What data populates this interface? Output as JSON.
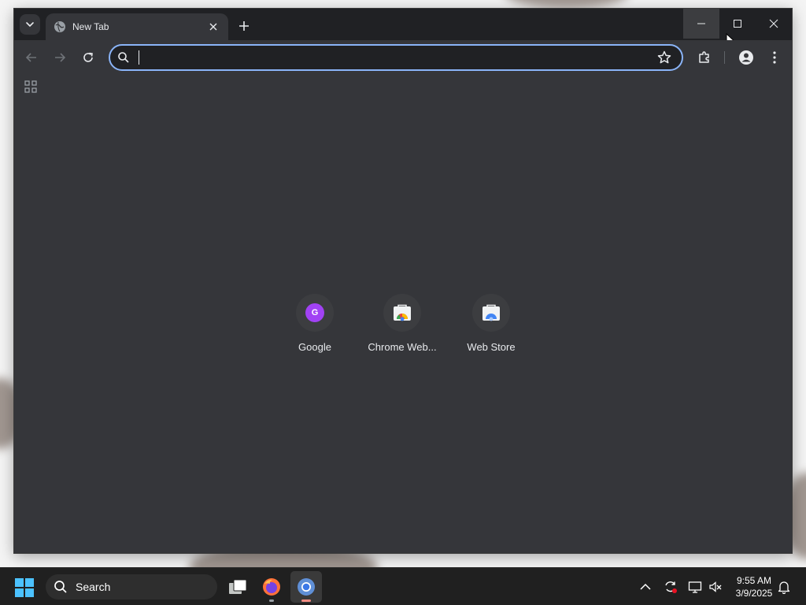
{
  "window": {
    "tab_title": "New Tab",
    "omnibox": {
      "value": "",
      "placeholder": ""
    }
  },
  "shortcuts": [
    {
      "label": "Google",
      "badge": "G"
    },
    {
      "label": "Chrome Web...",
      "badge": ""
    },
    {
      "label": "Web Store",
      "badge": ""
    }
  ],
  "taskbar": {
    "search_label": "Search",
    "time": "9:55 AM",
    "date": "3/9/2025"
  },
  "colors": {
    "frame": "#202124",
    "toolbar": "#35363a",
    "focus_ring": "#8ab4f8",
    "google_badge": "#a142f4",
    "taskbar": "#202020"
  }
}
